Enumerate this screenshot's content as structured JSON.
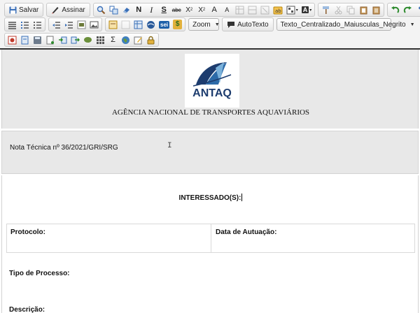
{
  "toolbar": {
    "save_label": "Salvar",
    "sign_label": "Assinar",
    "bold": "N",
    "italic": "I",
    "underline": "S",
    "strike": "abc",
    "subscript": "X",
    "superscript": "X",
    "sub_mark": "2",
    "sup_mark": "2",
    "font_up": "A",
    "font_down": "A",
    "text_color": "A",
    "omega": "Ω",
    "pilcrow": "¶",
    "sigma": "Σ",
    "sei_badge": "sei",
    "dollar": "$",
    "zoom_label": "Zoom",
    "autotexto_label": "AutoTexto",
    "style_value": "Texto_Centralizado_Maiusculas_Negrito"
  },
  "document": {
    "logo_text": "ANTAQ",
    "agency": "AGÊNCIA NACIONAL DE TRANSPORTES AQUAVIÁRIOS",
    "nota": "Nota Técnica nº 36/2021/GRI/SRG",
    "interessados": "INTERESSADO(S):",
    "protocolo": "Protocolo:",
    "data_atuacao": "Data de Autuação:",
    "tipo_processo": "Tipo de Processo:",
    "descricao": "Descrição:"
  },
  "colors": {
    "toolbar_bg": "#f3f3f3",
    "header_bg": "#e8e8e8",
    "logo_navy": "#1d3c6e",
    "logo_sky": "#7bb2db"
  }
}
